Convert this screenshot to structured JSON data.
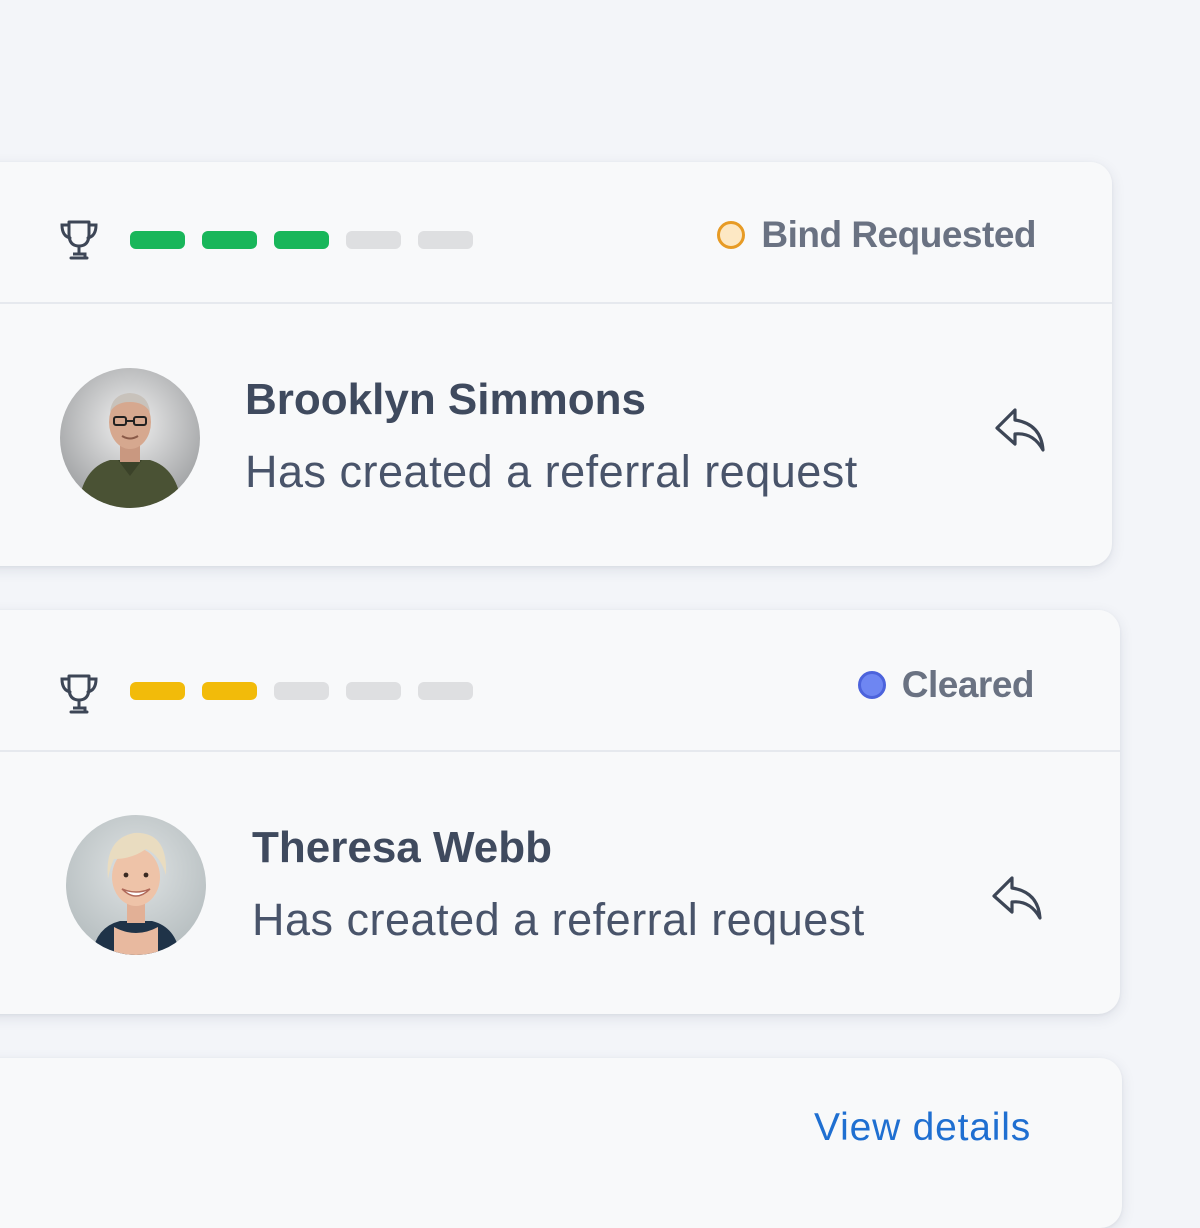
{
  "cards": [
    {
      "trophy_icon": "trophy-icon",
      "progress": {
        "total": 5,
        "filled": 3,
        "color": "#18b65a"
      },
      "status": {
        "label": "Bind Requested",
        "dot_color": "#e79b25"
      },
      "person": {
        "name": "Brooklyn Simmons",
        "message": "Has created a referral request"
      },
      "action_icon": "reply-icon"
    },
    {
      "trophy_icon": "trophy-icon",
      "progress": {
        "total": 5,
        "filled": 2,
        "color": "#f2bb0a"
      },
      "status": {
        "label": "Cleared",
        "dot_color": "#6e86f2"
      },
      "person": {
        "name": "Theresa Webb",
        "message": "Has created a referral request"
      },
      "action_icon": "reply-icon"
    }
  ],
  "footer": {
    "link_label": "View details"
  },
  "colors": {
    "background": "#f3f5f9",
    "card": "#f8f9fa",
    "link": "#1f6fd1",
    "text_primary": "#3f4a5e",
    "text_secondary": "#6a7282"
  }
}
